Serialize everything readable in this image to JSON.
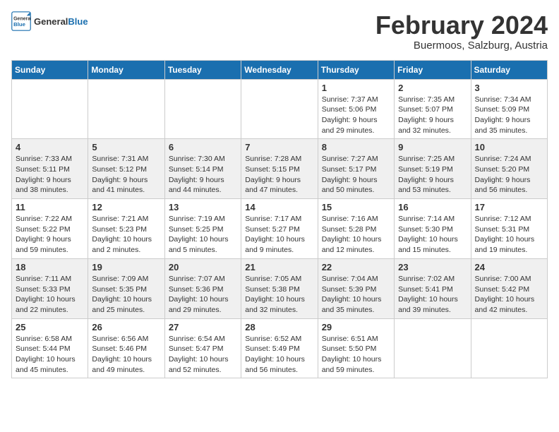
{
  "header": {
    "logo_general": "General",
    "logo_blue": "Blue",
    "month_title": "February 2024",
    "subtitle": "Buermoos, Salzburg, Austria"
  },
  "days_of_week": [
    "Sunday",
    "Monday",
    "Tuesday",
    "Wednesday",
    "Thursday",
    "Friday",
    "Saturday"
  ],
  "weeks": [
    {
      "days": [
        {
          "date": "",
          "info": ""
        },
        {
          "date": "",
          "info": ""
        },
        {
          "date": "",
          "info": ""
        },
        {
          "date": "",
          "info": ""
        },
        {
          "date": "1",
          "info": "Sunrise: 7:37 AM\nSunset: 5:06 PM\nDaylight: 9 hours and 29 minutes."
        },
        {
          "date": "2",
          "info": "Sunrise: 7:35 AM\nSunset: 5:07 PM\nDaylight: 9 hours and 32 minutes."
        },
        {
          "date": "3",
          "info": "Sunrise: 7:34 AM\nSunset: 5:09 PM\nDaylight: 9 hours and 35 minutes."
        }
      ]
    },
    {
      "days": [
        {
          "date": "4",
          "info": "Sunrise: 7:33 AM\nSunset: 5:11 PM\nDaylight: 9 hours and 38 minutes."
        },
        {
          "date": "5",
          "info": "Sunrise: 7:31 AM\nSunset: 5:12 PM\nDaylight: 9 hours and 41 minutes."
        },
        {
          "date": "6",
          "info": "Sunrise: 7:30 AM\nSunset: 5:14 PM\nDaylight: 9 hours and 44 minutes."
        },
        {
          "date": "7",
          "info": "Sunrise: 7:28 AM\nSunset: 5:15 PM\nDaylight: 9 hours and 47 minutes."
        },
        {
          "date": "8",
          "info": "Sunrise: 7:27 AM\nSunset: 5:17 PM\nDaylight: 9 hours and 50 minutes."
        },
        {
          "date": "9",
          "info": "Sunrise: 7:25 AM\nSunset: 5:19 PM\nDaylight: 9 hours and 53 minutes."
        },
        {
          "date": "10",
          "info": "Sunrise: 7:24 AM\nSunset: 5:20 PM\nDaylight: 9 hours and 56 minutes."
        }
      ]
    },
    {
      "days": [
        {
          "date": "11",
          "info": "Sunrise: 7:22 AM\nSunset: 5:22 PM\nDaylight: 9 hours and 59 minutes."
        },
        {
          "date": "12",
          "info": "Sunrise: 7:21 AM\nSunset: 5:23 PM\nDaylight: 10 hours and 2 minutes."
        },
        {
          "date": "13",
          "info": "Sunrise: 7:19 AM\nSunset: 5:25 PM\nDaylight: 10 hours and 5 minutes."
        },
        {
          "date": "14",
          "info": "Sunrise: 7:17 AM\nSunset: 5:27 PM\nDaylight: 10 hours and 9 minutes."
        },
        {
          "date": "15",
          "info": "Sunrise: 7:16 AM\nSunset: 5:28 PM\nDaylight: 10 hours and 12 minutes."
        },
        {
          "date": "16",
          "info": "Sunrise: 7:14 AM\nSunset: 5:30 PM\nDaylight: 10 hours and 15 minutes."
        },
        {
          "date": "17",
          "info": "Sunrise: 7:12 AM\nSunset: 5:31 PM\nDaylight: 10 hours and 19 minutes."
        }
      ]
    },
    {
      "days": [
        {
          "date": "18",
          "info": "Sunrise: 7:11 AM\nSunset: 5:33 PM\nDaylight: 10 hours and 22 minutes."
        },
        {
          "date": "19",
          "info": "Sunrise: 7:09 AM\nSunset: 5:35 PM\nDaylight: 10 hours and 25 minutes."
        },
        {
          "date": "20",
          "info": "Sunrise: 7:07 AM\nSunset: 5:36 PM\nDaylight: 10 hours and 29 minutes."
        },
        {
          "date": "21",
          "info": "Sunrise: 7:05 AM\nSunset: 5:38 PM\nDaylight: 10 hours and 32 minutes."
        },
        {
          "date": "22",
          "info": "Sunrise: 7:04 AM\nSunset: 5:39 PM\nDaylight: 10 hours and 35 minutes."
        },
        {
          "date": "23",
          "info": "Sunrise: 7:02 AM\nSunset: 5:41 PM\nDaylight: 10 hours and 39 minutes."
        },
        {
          "date": "24",
          "info": "Sunrise: 7:00 AM\nSunset: 5:42 PM\nDaylight: 10 hours and 42 minutes."
        }
      ]
    },
    {
      "days": [
        {
          "date": "25",
          "info": "Sunrise: 6:58 AM\nSunset: 5:44 PM\nDaylight: 10 hours and 45 minutes."
        },
        {
          "date": "26",
          "info": "Sunrise: 6:56 AM\nSunset: 5:46 PM\nDaylight: 10 hours and 49 minutes."
        },
        {
          "date": "27",
          "info": "Sunrise: 6:54 AM\nSunset: 5:47 PM\nDaylight: 10 hours and 52 minutes."
        },
        {
          "date": "28",
          "info": "Sunrise: 6:52 AM\nSunset: 5:49 PM\nDaylight: 10 hours and 56 minutes."
        },
        {
          "date": "29",
          "info": "Sunrise: 6:51 AM\nSunset: 5:50 PM\nDaylight: 10 hours and 59 minutes."
        },
        {
          "date": "",
          "info": ""
        },
        {
          "date": "",
          "info": ""
        }
      ]
    }
  ]
}
